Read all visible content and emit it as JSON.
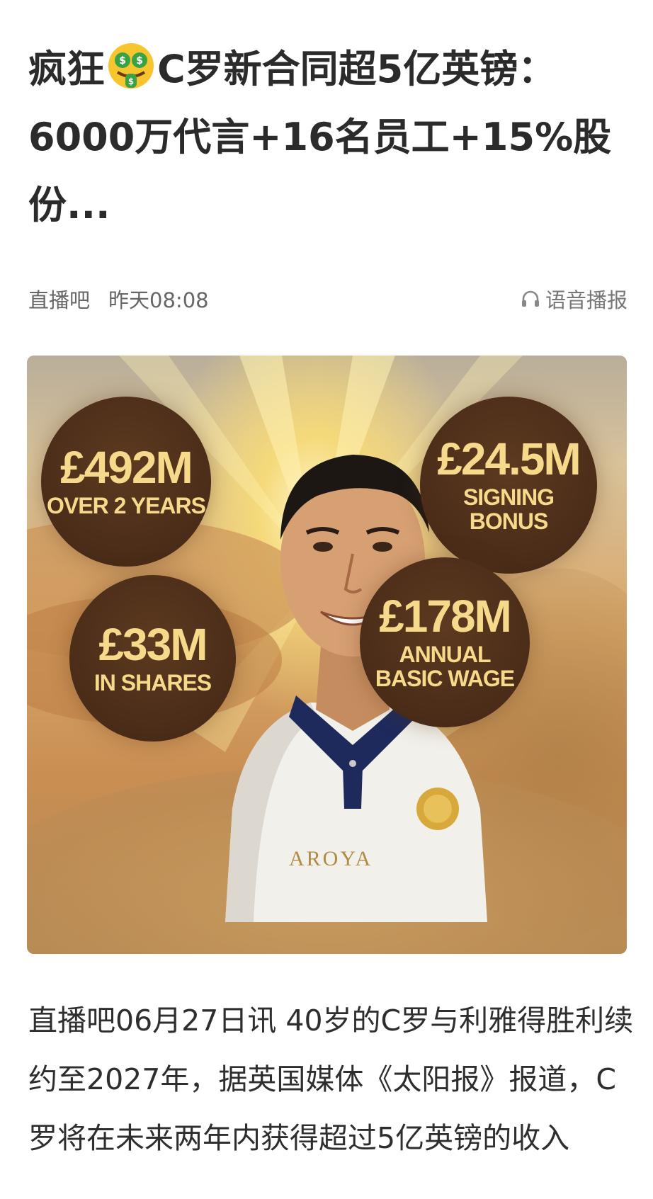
{
  "article": {
    "title_part1": "疯狂",
    "title_emoji": "money-mouth-face-icon",
    "title_part2": "C罗新合同超5亿英镑：6000万代言+16名员工+15%股份...",
    "source": "直播吧",
    "time": "昨天08:08",
    "audio_label": "语音播报",
    "body": "直播吧06月27日讯 40岁的C罗与利雅得胜利续约至2027年，据英国媒体《太阳报》报道，C罗将在未来两年内获得超过5亿英镑的收入"
  },
  "hero_image": {
    "jersey_text": "AROYA",
    "stats": [
      {
        "amount": "£492M",
        "label_line1": "OVER 2 YEARS",
        "label_line2": ""
      },
      {
        "amount": "£24.5M",
        "label_line1": "SIGNING",
        "label_line2": "BONUS"
      },
      {
        "amount": "£33M",
        "label_line1": "IN SHARES",
        "label_line2": ""
      },
      {
        "amount": "£178M",
        "label_line1": "ANNUAL",
        "label_line2": "BASIC WAGE"
      }
    ]
  },
  "colors": {
    "bubble_text": "#f6d98a",
    "bubble_bg": "#4a2c18",
    "meta_text": "#666666"
  }
}
